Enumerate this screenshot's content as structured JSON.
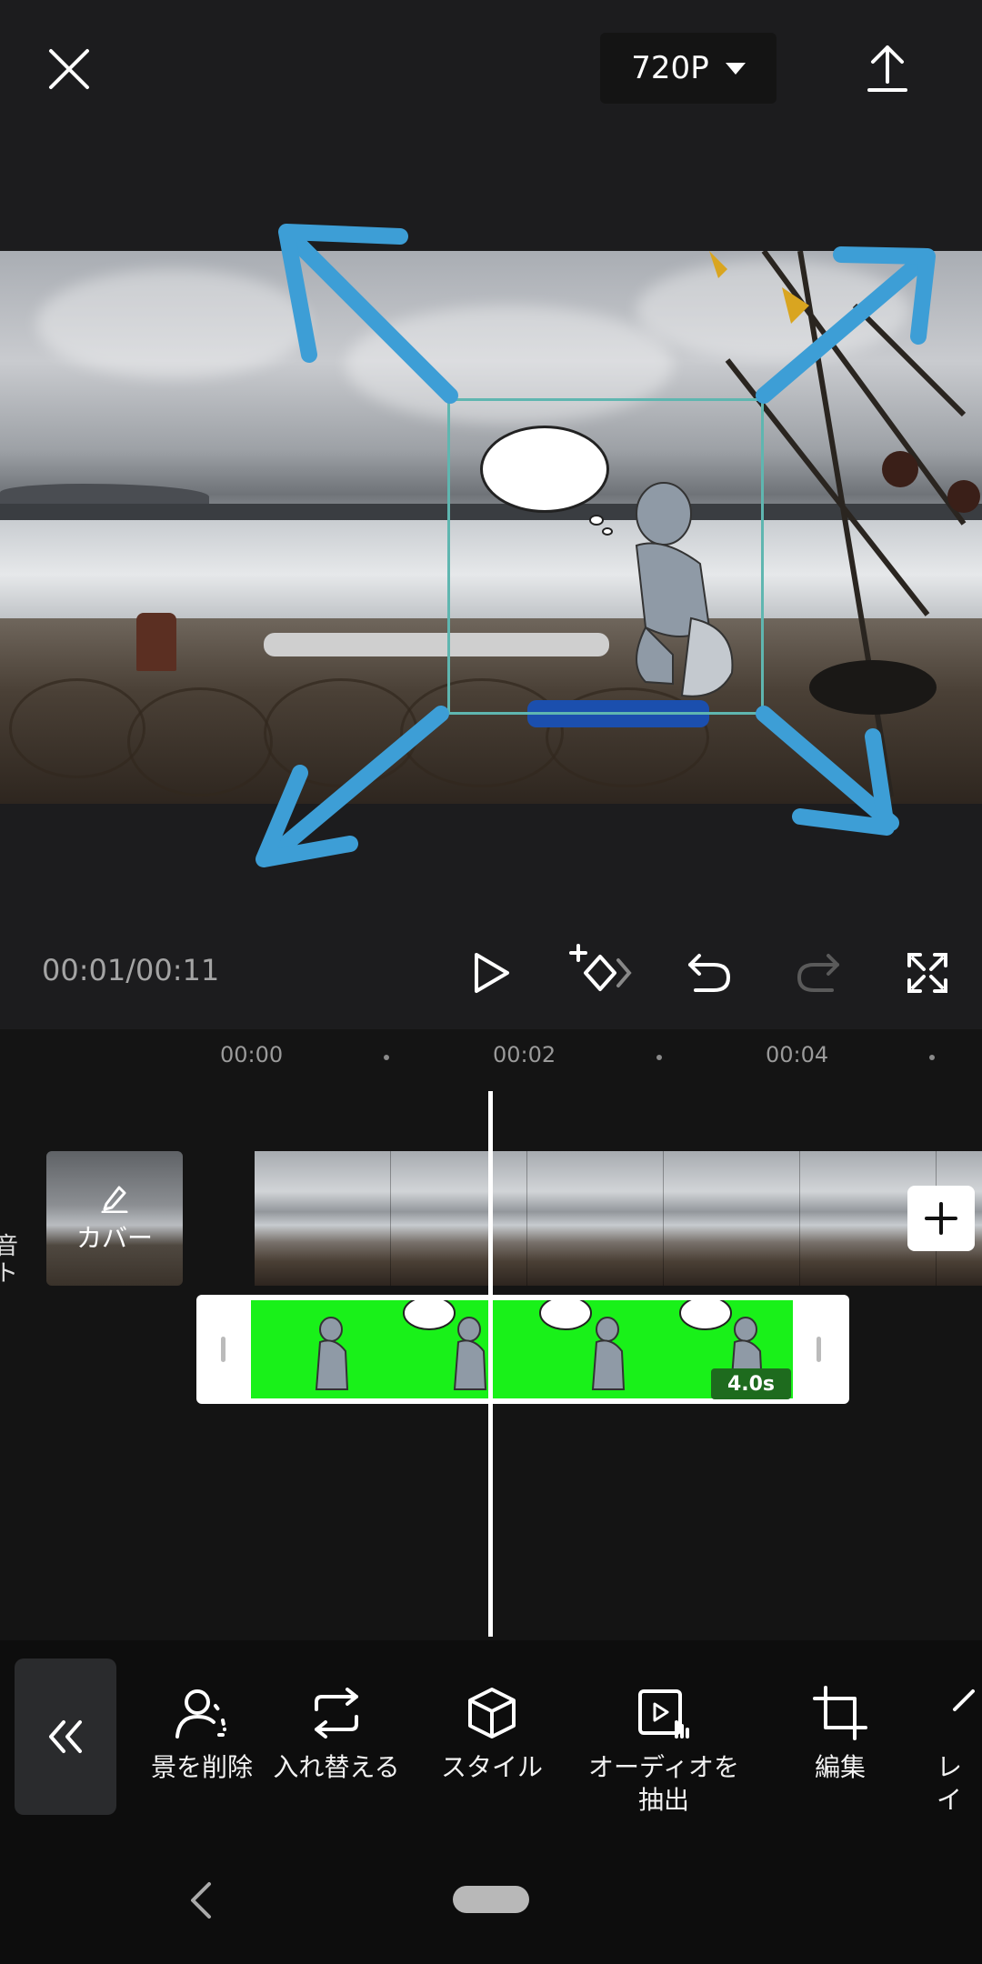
{
  "header": {
    "close_icon": "close-icon",
    "resolution": "720P",
    "export_icon": "upload-icon"
  },
  "playback": {
    "time": "00:01/00:11"
  },
  "timeline": {
    "ticks": [
      "00:00",
      "00:02",
      "00:04"
    ],
    "side_label": "音\nト",
    "cover_label": "カバー",
    "clip_duration": "4.0s"
  },
  "toolbar": {
    "tools": [
      {
        "label": "景を削除",
        "icon": "remove-background-icon"
      },
      {
        "label": "入れ替える",
        "icon": "swap-icon"
      },
      {
        "label": "スタイル",
        "icon": "cube-icon"
      },
      {
        "label": "オーディオを\n抽出",
        "icon": "extract-audio-icon"
      },
      {
        "label": "編集",
        "icon": "crop-icon"
      },
      {
        "label": "レイ",
        "icon": "layer-icon"
      }
    ]
  },
  "colors": {
    "background": "#1c1c1e",
    "timeline_bg": "#141414",
    "overlay_green": "#19f119",
    "selection": "#5fb6b0",
    "arrow_annotation": "#3d9ed6"
  }
}
